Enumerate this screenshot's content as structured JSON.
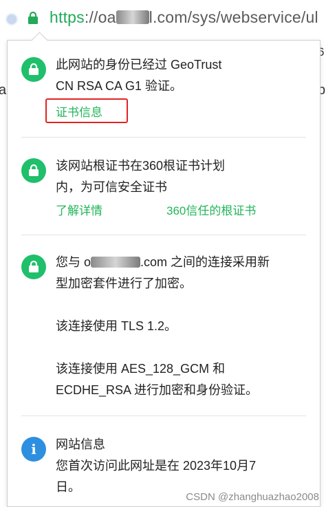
{
  "address_bar": {
    "protocol": "https",
    "url_prefix": "://oa",
    "url_suffix": "l.com/sys/webservice/ul"
  },
  "background": {
    "hint_right": "6",
    "hint_a": "a",
    "hint_p": "p"
  },
  "panel": {
    "identity": {
      "line1": "此网站的身份已经过 GeoTrust",
      "line2": "CN RSA CA G1 验证。",
      "cert_link": "证书信息"
    },
    "root_cert": {
      "line1": "该网站根证书在360根证书计划",
      "line2": "内，为可信安全证书",
      "details_link": "了解详情",
      "trusted_link": "360信任的根证书"
    },
    "encryption": {
      "line1_prefix": "您与 o",
      "line1_suffix": ".com 之间的连接采用新",
      "line2": "型加密套件进行了加密。",
      "tls": "该连接使用 TLS 1.2。",
      "cipher1": "该连接使用 AES_128_GCM 和",
      "cipher2": "ECDHE_RSA 进行加密和身份验证。"
    },
    "site_info": {
      "title": "网站信息",
      "line1": "您首次访问此网址是在 2023年10月7",
      "line2": "日。"
    }
  },
  "watermark": "CSDN @zhanghuazhao2008",
  "colors": {
    "accent_green": "#1fbf6b",
    "link_green": "#23b55b",
    "info_blue": "#2e8fe0",
    "highlight_red": "#e32222"
  }
}
